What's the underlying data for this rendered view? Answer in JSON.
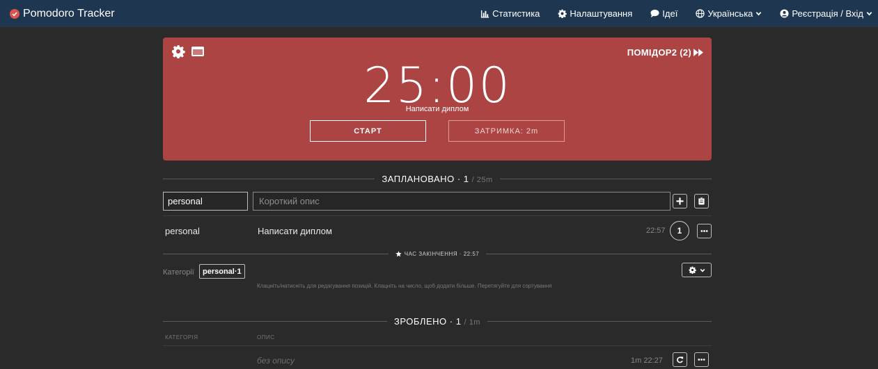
{
  "app": {
    "name": "Pomodoro Tracker"
  },
  "nav": {
    "stats": "Статистика",
    "settings": "Налаштування",
    "ideas": "Ідеї",
    "language": "Українська",
    "auth": "Реєстрація / Вхід"
  },
  "timer": {
    "next_label": "ПОМІДОР2 (2)",
    "time": "25:00",
    "task": "Написати диплом",
    "start_label": "СТАРТ",
    "delay_label": "ЗАТРИМКА: 2m"
  },
  "planned": {
    "heading": "ЗАПЛАНОВАНО",
    "count": "1",
    "duration": "25m",
    "category_input_value": "personal",
    "description_placeholder": "Короткий опис",
    "tasks": [
      {
        "category": "personal",
        "description": "Написати диплом",
        "time": "22:57",
        "count": "1"
      }
    ],
    "end_time_heading": "ЧАС ЗАКІНЧЕННЯ · 22:57"
  },
  "categories": {
    "label": "Категорії",
    "chips": [
      {
        "name": "personal",
        "count": "1"
      }
    ],
    "hint": "Клацніть/натисніть для редагування позицій. Клацніть на число, щоб додати більше. Перетягуйте для сортування"
  },
  "done": {
    "heading": "ЗРОБЛЕНО",
    "count": "1",
    "duration": "1m",
    "col_category": "КАТЕГОРІЯ",
    "col_description": "ОПИС",
    "tasks": [
      {
        "description": "без опису",
        "duration": "1m",
        "time": "22:27"
      }
    ]
  },
  "colors": {
    "navbar": "#1e3650",
    "card": "#ac4444",
    "background": "#2a2a2a"
  },
  "icons": [
    "check-circle-icon",
    "bar-chart-icon",
    "gear-icon",
    "chat-bubble-icon",
    "globe-icon",
    "chevron-down-icon",
    "user-circle-icon",
    "fast-forward-icon",
    "window-icon",
    "plus-icon",
    "clipboard-icon",
    "star-icon",
    "more-icon",
    "redo-icon"
  ]
}
